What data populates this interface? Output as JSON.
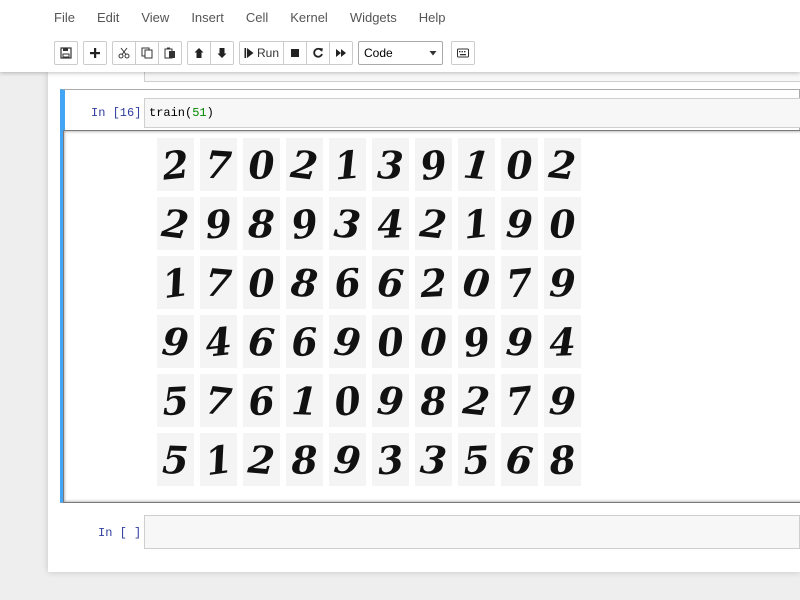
{
  "menubar": {
    "items": [
      {
        "label": "File"
      },
      {
        "label": "Edit"
      },
      {
        "label": "View"
      },
      {
        "label": "Insert"
      },
      {
        "label": "Cell"
      },
      {
        "label": "Kernel"
      },
      {
        "label": "Widgets"
      },
      {
        "label": "Help"
      }
    ]
  },
  "toolbar": {
    "save_icon": "floppy-disk-icon",
    "add_icon": "plus-icon",
    "cut_icon": "scissors-icon",
    "copy_icon": "copy-icon",
    "paste_icon": "paste-icon",
    "move_up_icon": "arrow-up-icon",
    "move_down_icon": "arrow-down-icon",
    "run_label": "Run",
    "stop_icon": "stop-square-icon",
    "restart_icon": "restart-icon",
    "fast_forward_icon": "fast-forward-icon",
    "cell_type": "Code",
    "keyboard_icon": "keyboard-icon"
  },
  "cells": {
    "active": {
      "prompt": "In [16]:",
      "code_fn": "train(",
      "code_arg": "51",
      "code_close": ")",
      "output_digits": [
        [
          "2",
          "7",
          "0",
          "2",
          "1",
          "3",
          "9",
          "1",
          "0",
          "2"
        ],
        [
          "2",
          "9",
          "8",
          "9",
          "3",
          "4",
          "2",
          "1",
          "9",
          "0"
        ],
        [
          "1",
          "7",
          "0",
          "8",
          "6",
          "6",
          "2",
          "0",
          "7",
          "9"
        ],
        [
          "9",
          "4",
          "6",
          "6",
          "9",
          "0",
          "0",
          "9",
          "9",
          "4"
        ],
        [
          "5",
          "7",
          "6",
          "1",
          "0",
          "9",
          "8",
          "2",
          "7",
          "9"
        ],
        [
          "5",
          "1",
          "2",
          "8",
          "9",
          "3",
          "3",
          "5",
          "6",
          "8"
        ]
      ]
    },
    "empty": {
      "prompt": "In [ ]:"
    }
  }
}
